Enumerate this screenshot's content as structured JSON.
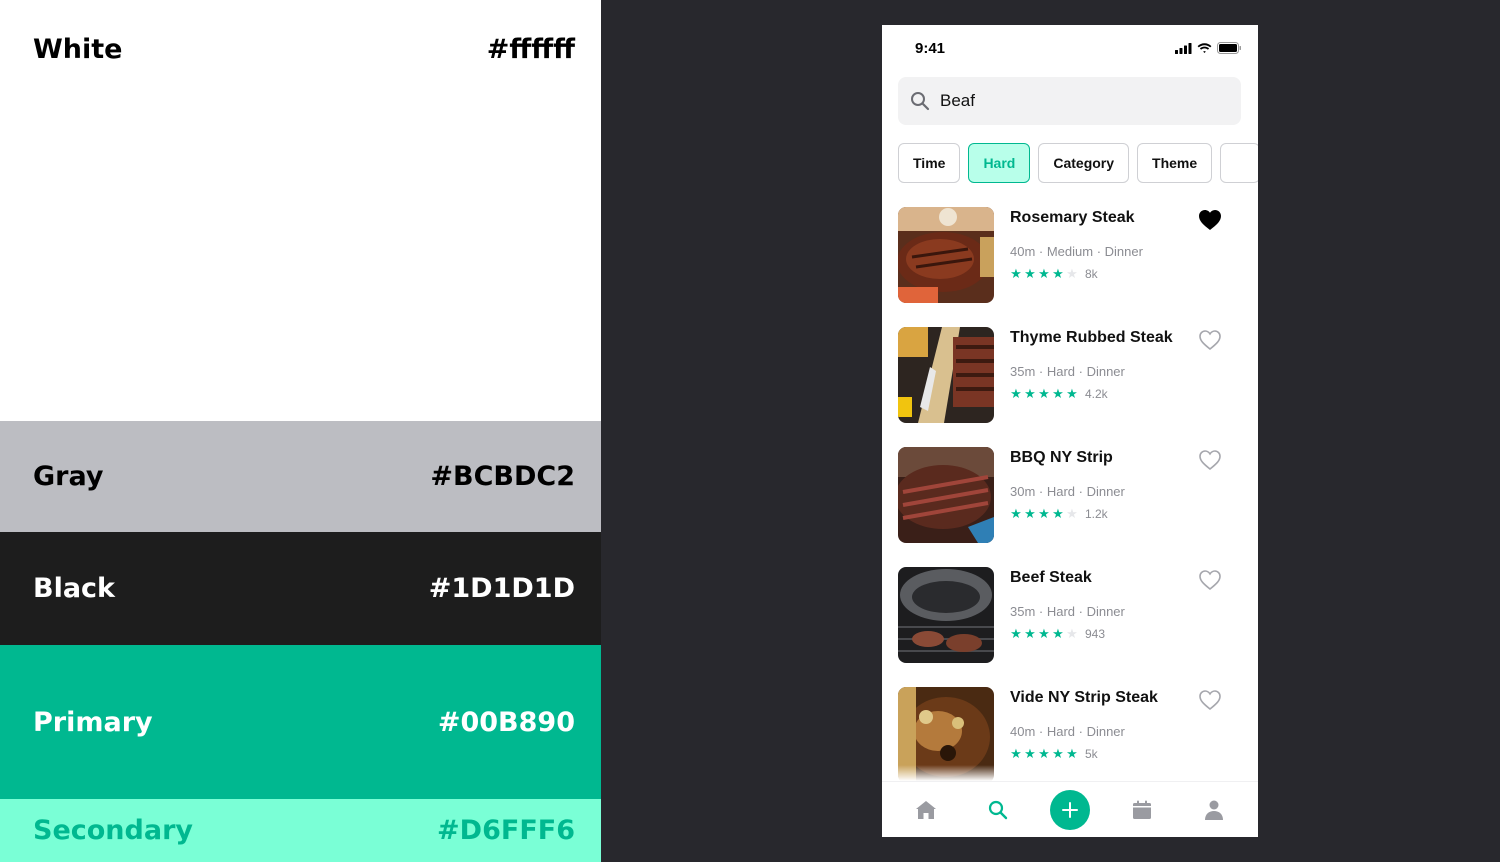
{
  "palette": [
    {
      "name": "White",
      "hex": "#ffffff"
    },
    {
      "name": "Gray",
      "hex": "#BCBDC2"
    },
    {
      "name": "Black",
      "hex": "#1D1D1D"
    },
    {
      "name": "Primary",
      "hex": "#00B890"
    },
    {
      "name": "Secondary",
      "hex": "#D6FFF6"
    }
  ],
  "colors": {
    "primary": "#00B890",
    "secondary_swatch_bg": "#7AFFD6",
    "chip_active_bg": "#B8FFEA",
    "page_bg": "#28282d",
    "muted_text": "#8b8c92"
  },
  "status": {
    "time": "9:41",
    "icons": [
      "signal-icon",
      "wifi-icon",
      "battery-icon"
    ]
  },
  "search": {
    "value": "Beaf",
    "icon": "search-icon"
  },
  "filters": [
    {
      "label": "Time",
      "active": false
    },
    {
      "label": "Hard",
      "active": true
    },
    {
      "label": "Category",
      "active": false
    },
    {
      "label": "Theme",
      "active": false
    },
    {
      "label": "",
      "active": false
    }
  ],
  "recipes": [
    {
      "title": "Rosemary Steak",
      "meta": "40m · Medium · Dinner",
      "stars": 4,
      "max_stars": 5,
      "count": "8k",
      "favorite": true
    },
    {
      "title": "Thyme Rubbed Steak",
      "meta": "35m · Hard · Dinner",
      "stars": 5,
      "max_stars": 5,
      "count": "4.2k",
      "favorite": false
    },
    {
      "title": "BBQ NY Strip",
      "meta": "30m · Hard · Dinner",
      "stars": 4,
      "max_stars": 5,
      "count": "1.2k",
      "favorite": false
    },
    {
      "title": "Beef Steak",
      "meta": "35m · Hard · Dinner",
      "stars": 4,
      "max_stars": 5,
      "count": "943",
      "favorite": false
    },
    {
      "title": "Vide NY Strip Steak",
      "meta": "40m · Hard · Dinner",
      "stars": 5,
      "max_stars": 5,
      "count": "5k",
      "favorite": false
    }
  ],
  "tabbar": [
    {
      "icon": "home-icon",
      "active": false
    },
    {
      "icon": "search-icon",
      "active": true
    },
    {
      "icon": "plus-icon",
      "active": false
    },
    {
      "icon": "calendar-icon",
      "active": false
    },
    {
      "icon": "profile-icon",
      "active": false
    }
  ]
}
